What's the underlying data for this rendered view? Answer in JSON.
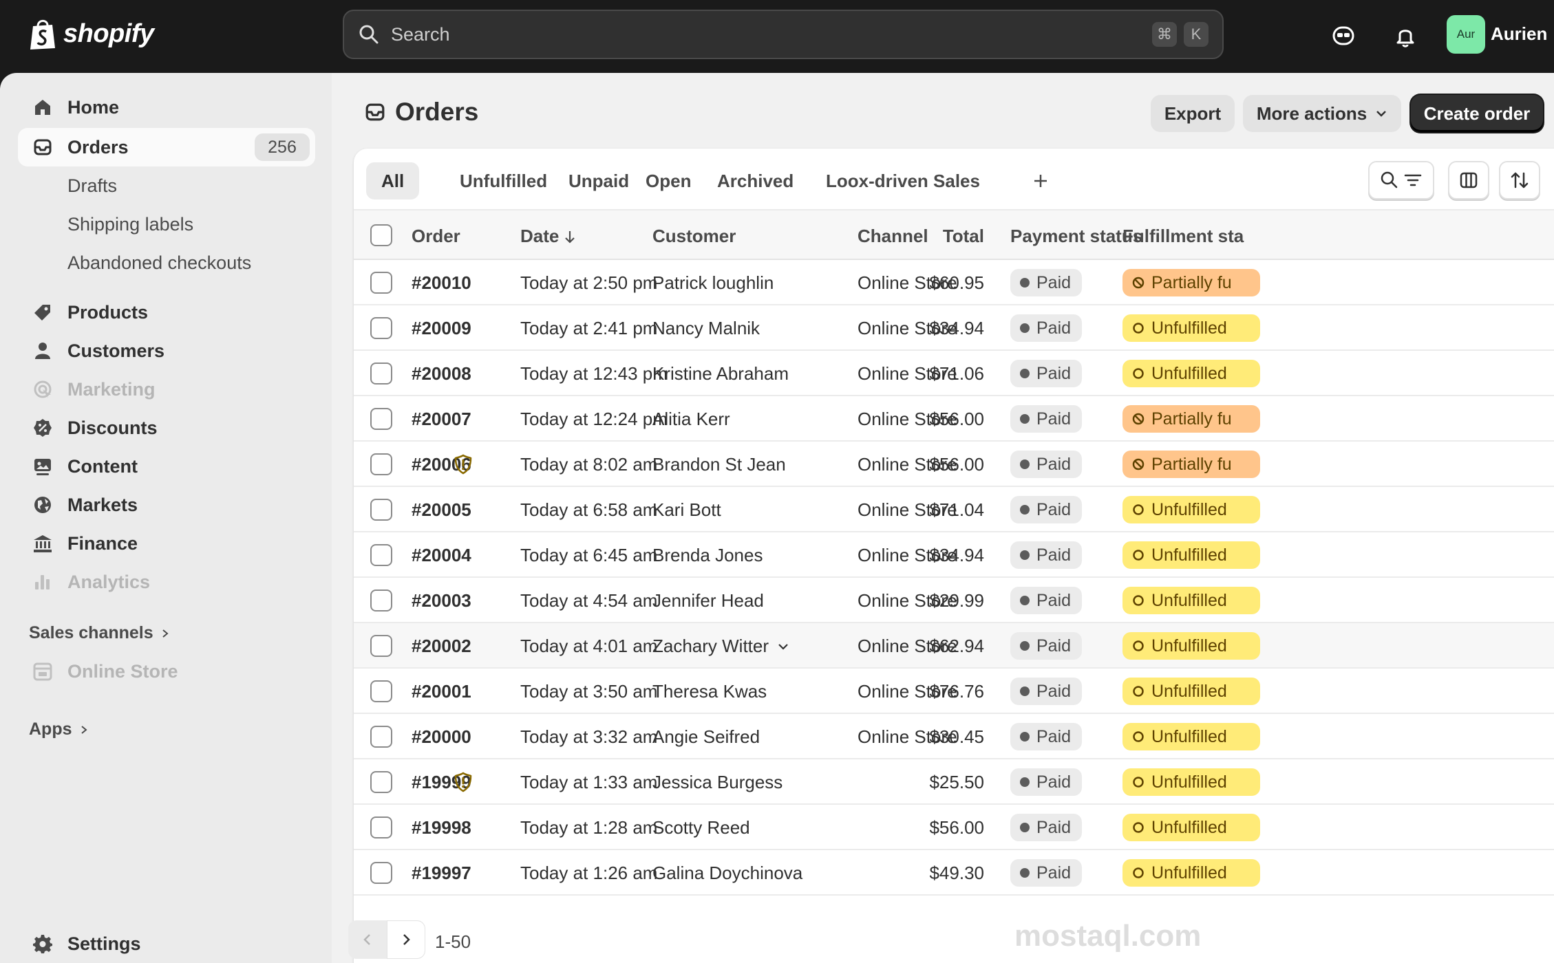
{
  "brand": {
    "name": "shopify"
  },
  "search": {
    "placeholder": "Search",
    "shortcut_cmd": "⌘",
    "shortcut_key": "K"
  },
  "user": {
    "initials": "Aur",
    "name": "Aurien",
    "avatar_color": "#7de8a8"
  },
  "sidebar": {
    "items": [
      {
        "label": "Home",
        "icon": "home-icon"
      },
      {
        "label": "Orders",
        "icon": "orders-icon",
        "badge": "256",
        "active": true
      },
      {
        "label": "Drafts",
        "sub": true
      },
      {
        "label": "Shipping labels",
        "sub": true
      },
      {
        "label": "Abandoned checkouts",
        "sub": true
      },
      {
        "label": "Products",
        "icon": "tag-icon"
      },
      {
        "label": "Customers",
        "icon": "person-icon"
      },
      {
        "label": "Marketing",
        "icon": "target-icon",
        "disabled": true
      },
      {
        "label": "Discounts",
        "icon": "discount-icon"
      },
      {
        "label": "Content",
        "icon": "content-icon"
      },
      {
        "label": "Markets",
        "icon": "globe-icon"
      },
      {
        "label": "Finance",
        "icon": "bank-icon"
      },
      {
        "label": "Analytics",
        "icon": "chart-icon",
        "disabled": true
      }
    ],
    "sales_channels_label": "Sales channels",
    "online_store_label": "Online Store",
    "apps_label": "Apps",
    "settings_label": "Settings"
  },
  "page": {
    "title": "Orders",
    "export_label": "Export",
    "more_actions_label": "More actions",
    "create_order_label": "Create order"
  },
  "tabs": [
    "All",
    "Unfulfilled",
    "Unpaid",
    "Open",
    "Archived",
    "Loox-driven Sales"
  ],
  "columns": {
    "order": "Order",
    "date": "Date",
    "customer": "Customer",
    "channel": "Channel",
    "total": "Total",
    "payment_status": "Payment status",
    "fulfillment_status": "Fulfillment sta"
  },
  "orders": [
    {
      "order": "#20010",
      "date": "Today at 2:50 pm",
      "customer": "Patrick loughlin",
      "channel": "Online Store",
      "total": "$60.95",
      "payment": "Paid",
      "fulfillment": "Partially fu",
      "fstatus": "partial"
    },
    {
      "order": "#20009",
      "date": "Today at 2:41 pm",
      "customer": "Nancy Malnik",
      "channel": "Online Store",
      "total": "$34.94",
      "payment": "Paid",
      "fulfillment": "Unfulfilled",
      "fstatus": "unfulfilled"
    },
    {
      "order": "#20008",
      "date": "Today at 12:43 pm",
      "customer": "Kristine Abraham",
      "channel": "Online Store",
      "total": "$71.06",
      "payment": "Paid",
      "fulfillment": "Unfulfilled",
      "fstatus": "unfulfilled"
    },
    {
      "order": "#20007",
      "date": "Today at 12:24 pm",
      "customer": "Alitia Kerr",
      "channel": "Online Store",
      "total": "$56.00",
      "payment": "Paid",
      "fulfillment": "Partially fu",
      "fstatus": "partial"
    },
    {
      "order": "#20006",
      "date": "Today at 8:02 am",
      "customer": "Brandon St Jean",
      "channel": "Online Store",
      "total": "$56.00",
      "payment": "Paid",
      "fulfillment": "Partially fu",
      "fstatus": "partial",
      "alert": true
    },
    {
      "order": "#20005",
      "date": "Today at 6:58 am",
      "customer": "Kari Bott",
      "channel": "Online Store",
      "total": "$71.04",
      "payment": "Paid",
      "fulfillment": "Unfulfilled",
      "fstatus": "unfulfilled"
    },
    {
      "order": "#20004",
      "date": "Today at 6:45 am",
      "customer": "Brenda Jones",
      "channel": "Online Store",
      "total": "$34.94",
      "payment": "Paid",
      "fulfillment": "Unfulfilled",
      "fstatus": "unfulfilled"
    },
    {
      "order": "#20003",
      "date": "Today at 4:54 am",
      "customer": "Jennifer Head",
      "channel": "Online Store",
      "total": "$29.99",
      "payment": "Paid",
      "fulfillment": "Unfulfilled",
      "fstatus": "unfulfilled"
    },
    {
      "order": "#20002",
      "date": "Today at 4:01 am",
      "customer": "Zachary Witter",
      "channel": "Online Store",
      "total": "$62.94",
      "payment": "Paid",
      "fulfillment": "Unfulfilled",
      "fstatus": "unfulfilled",
      "highlight": true,
      "expand": true
    },
    {
      "order": "#20001",
      "date": "Today at 3:50 am",
      "customer": "Theresa Kwas",
      "channel": "Online Store",
      "total": "$76.76",
      "payment": "Paid",
      "fulfillment": "Unfulfilled",
      "fstatus": "unfulfilled"
    },
    {
      "order": "#20000",
      "date": "Today at 3:32 am",
      "customer": "Angie Seifred",
      "channel": "Online Store",
      "total": "$30.45",
      "payment": "Paid",
      "fulfillment": "Unfulfilled",
      "fstatus": "unfulfilled"
    },
    {
      "order": "#19999",
      "date": "Today at 1:33 am",
      "customer": "Jessica Burgess",
      "channel": "",
      "total": "$25.50",
      "payment": "Paid",
      "fulfillment": "Unfulfilled",
      "fstatus": "unfulfilled",
      "alert": true
    },
    {
      "order": "#19998",
      "date": "Today at 1:28 am",
      "customer": "Scotty Reed",
      "channel": "",
      "total": "$56.00",
      "payment": "Paid",
      "fulfillment": "Unfulfilled",
      "fstatus": "unfulfilled"
    },
    {
      "order": "#19997",
      "date": "Today at 1:26 am",
      "customer": "Galina Doychinova",
      "channel": "",
      "total": "$49.30",
      "payment": "Paid",
      "fulfillment": "Unfulfilled",
      "fstatus": "unfulfilled"
    }
  ],
  "pagination": {
    "range": "1-50"
  },
  "watermark": "mostaql.com",
  "colors": {
    "partial": "#ffc58b",
    "unfulfilled": "#ffeb78",
    "alert": "#8a6a00"
  }
}
